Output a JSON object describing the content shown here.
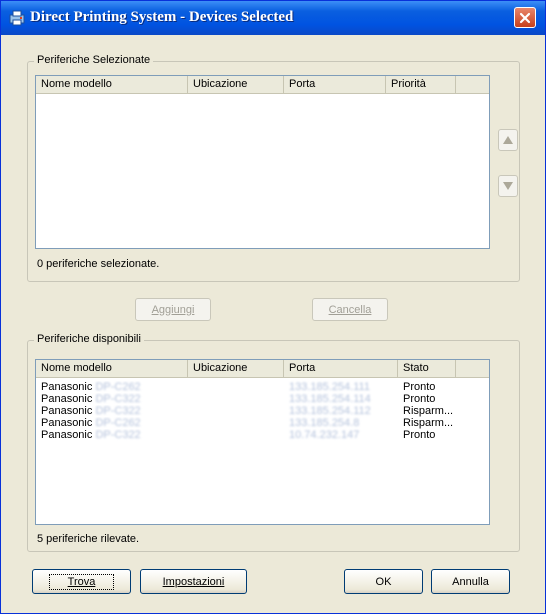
{
  "window": {
    "title": "Direct Printing System - Devices Selected",
    "titlebar_color": "#0a5fe0",
    "close_icon": "close-icon"
  },
  "selected": {
    "group_label": "Periferiche Selezionate",
    "columns": [
      "Nome modello",
      "Ubicazione",
      "Porta",
      "Priorità"
    ],
    "rows": [],
    "status": "0 periferiche selezionate."
  },
  "actions": {
    "add_label": "Aggiungi",
    "remove_label": "Cancella"
  },
  "available": {
    "group_label": "Periferiche disponibili",
    "columns": [
      "Nome modello",
      "Ubicazione",
      "Porta",
      "Stato"
    ],
    "rows": [
      {
        "model": "Panasonic",
        "model_suffix": "DP-C262",
        "location": "",
        "port": "133.185.254.111",
        "status": "Pronto"
      },
      {
        "model": "Panasonic",
        "model_suffix": "DP-C322",
        "location": "",
        "port": "133.185.254.114",
        "status": "Pronto"
      },
      {
        "model": "Panasonic",
        "model_suffix": "DP-C322",
        "location": "",
        "port": "133.185.254.112",
        "status": "Risparm..."
      },
      {
        "model": "Panasonic",
        "model_suffix": "DP-C262",
        "location": "",
        "port": "133.185.254.8",
        "status": "Risparm..."
      },
      {
        "model": "Panasonic",
        "model_suffix": "DP-C322",
        "location": "",
        "port": "10.74.232.147",
        "status": "Pronto"
      }
    ],
    "status": "5 periferiche rilevate."
  },
  "footer": {
    "find_label": "Trova",
    "settings_label": "Impostazioni",
    "ok_label": "OK",
    "cancel_label": "Annulla"
  }
}
